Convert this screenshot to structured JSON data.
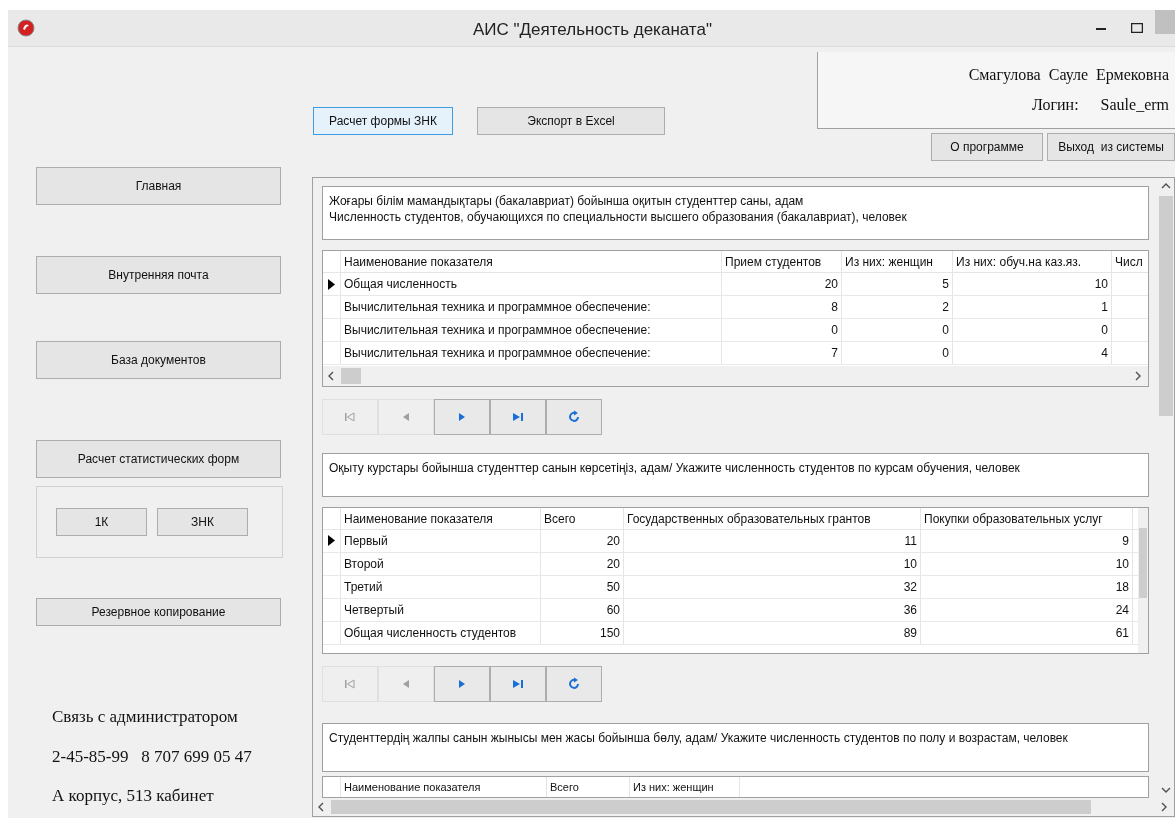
{
  "window": {
    "title": "АИС \"Деятельность деканата\""
  },
  "toolbar": [
    {
      "label": "Расчет формы ЗНК",
      "focused": true
    },
    {
      "label": "Экспорт в Excel",
      "focused": false
    }
  ],
  "user": {
    "name": "Смагулова  Сауле  Ермековна",
    "login_label": "Логин:",
    "login": "Saule_erm"
  },
  "top_buttons": [
    "О программе",
    "Выход  из системы"
  ],
  "sidebar": {
    "items": [
      {
        "kind": "button",
        "label": "Главная"
      },
      {
        "kind": "button",
        "label": "Внутренняя почта"
      },
      {
        "kind": "button",
        "label": "База документов"
      },
      {
        "kind": "button",
        "label": "Расчет статистических форм"
      },
      {
        "kind": "group",
        "buttons": [
          "1К",
          "ЗНК"
        ]
      },
      {
        "kind": "button",
        "label": "Резервное копирование"
      }
    ],
    "contact": [
      "Связь с администратором",
      "2-45-85-99   8 707 699 05 47",
      "А корпус, 513 кабинет"
    ]
  },
  "sections": [
    {
      "caption": "Жоғары білім мамандықтары (бакалавриат) бойынша оқитын студенттер саны, адам\nЧисленность студентов, обучающихся по специальности высшего образования (бакалавриат), человек",
      "table": {
        "columns": [
          "Наименование показателя",
          "Прием студентов",
          "Из них: женщин",
          "Из них: обуч.на каз.яз.",
          "Числ"
        ],
        "rows": [
          {
            "selected": true,
            "cells": [
              "Общая численность",
              "20",
              "5",
              "10",
              ""
            ]
          },
          {
            "selected": false,
            "cells": [
              "Вычислительная техника и программное обеспечение:",
              "8",
              "2",
              "1",
              ""
            ]
          },
          {
            "selected": false,
            "cells": [
              "Вычислительная техника и программное обеспечение:",
              "0",
              "0",
              "0",
              ""
            ]
          },
          {
            "selected": false,
            "cells": [
              "Вычислительная техника и программное обеспечение:",
              "7",
              "0",
              "4",
              ""
            ]
          }
        ]
      },
      "navigator": [
        {
          "kind": "first",
          "disabled": true
        },
        {
          "kind": "prev",
          "disabled": true
        },
        {
          "kind": "next",
          "disabled": false
        },
        {
          "kind": "last",
          "disabled": false
        },
        {
          "kind": "refresh",
          "disabled": false
        }
      ]
    },
    {
      "caption": "Оқыту курстары бойынша студенттер санын көрсетіңіз, адам/ Укажите численность студентов по курсам обучения, человек",
      "table": {
        "columns": [
          "Наименование показателя",
          "Всего",
          "Государственных образовательных грантов",
          "Покупки образовательных услуг"
        ],
        "rows": [
          {
            "selected": true,
            "cells": [
              "Первый",
              "20",
              "11",
              "9"
            ]
          },
          {
            "selected": false,
            "cells": [
              "Второй",
              "20",
              "10",
              "10"
            ]
          },
          {
            "selected": false,
            "cells": [
              "Третий",
              "50",
              "32",
              "18"
            ]
          },
          {
            "selected": false,
            "cells": [
              "Четвертый",
              "60",
              "36",
              "24"
            ]
          },
          {
            "selected": false,
            "cells": [
              "Общая численность студентов",
              "150",
              "89",
              "61"
            ]
          }
        ]
      },
      "navigator": [
        {
          "kind": "first",
          "disabled": true
        },
        {
          "kind": "prev",
          "disabled": true
        },
        {
          "kind": "next",
          "disabled": false
        },
        {
          "kind": "last",
          "disabled": false
        },
        {
          "kind": "refresh",
          "disabled": false
        }
      ]
    },
    {
      "caption": "Студенттердің жалпы санын жынысы мен жасы бойынша бөлу, адам/ Укажите численность студентов по полу и возрастам, человек",
      "table": {
        "columns": [
          "Наименование показателя",
          "Всего",
          "Из них: женщин"
        ]
      }
    }
  ]
}
